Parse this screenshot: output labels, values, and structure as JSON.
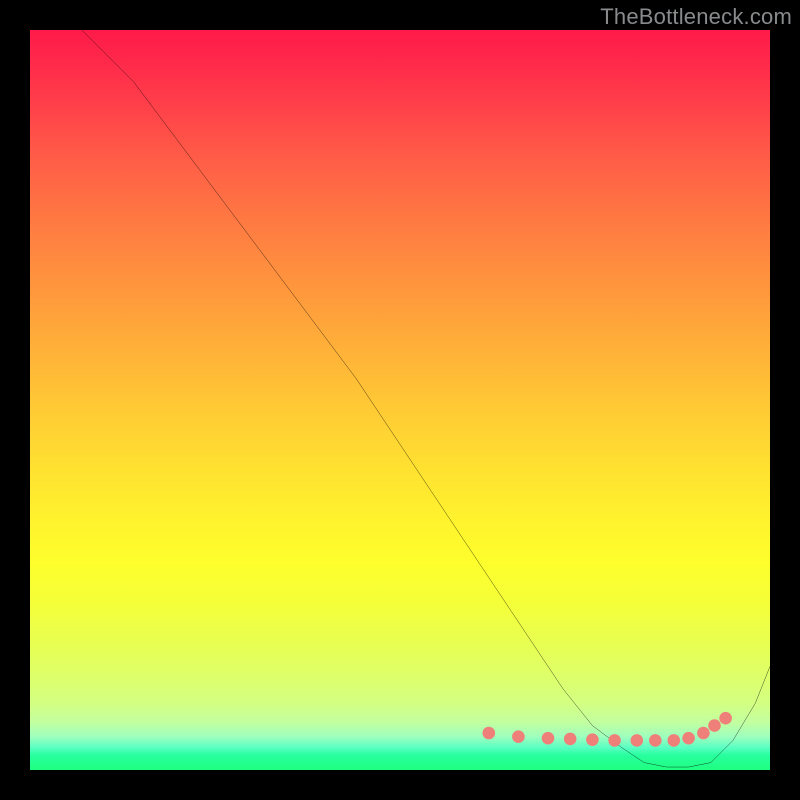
{
  "watermark": "TheBottleneck.com",
  "chart_data": {
    "type": "line",
    "title": "",
    "xlabel": "",
    "ylabel": "",
    "xlim": [
      0,
      100
    ],
    "ylim": [
      0,
      100
    ],
    "grid": false,
    "legend": false,
    "background": "rainbow-gradient",
    "series": [
      {
        "name": "curve",
        "color": "#000000",
        "x": [
          7,
          10,
          14,
          20,
          26,
          32,
          38,
          44,
          50,
          56,
          60,
          64,
          68,
          72,
          76,
          80,
          83,
          86,
          89,
          92,
          95,
          98,
          100
        ],
        "y": [
          100,
          97,
          93,
          85,
          77,
          69,
          61,
          53,
          44,
          35,
          29,
          23,
          17,
          11,
          6,
          3,
          1,
          0.4,
          0.4,
          1,
          4,
          9,
          14
        ]
      },
      {
        "name": "markers",
        "color": "#ef8079",
        "type": "scatter",
        "x": [
          62,
          66,
          70,
          73,
          76,
          79,
          82,
          84.5,
          87,
          89,
          91,
          92.5,
          94
        ],
        "y": [
          5.0,
          4.5,
          4.3,
          4.2,
          4.1,
          4.0,
          4.0,
          4.0,
          4.0,
          4.3,
          5.0,
          6.0,
          7.0
        ]
      }
    ]
  }
}
